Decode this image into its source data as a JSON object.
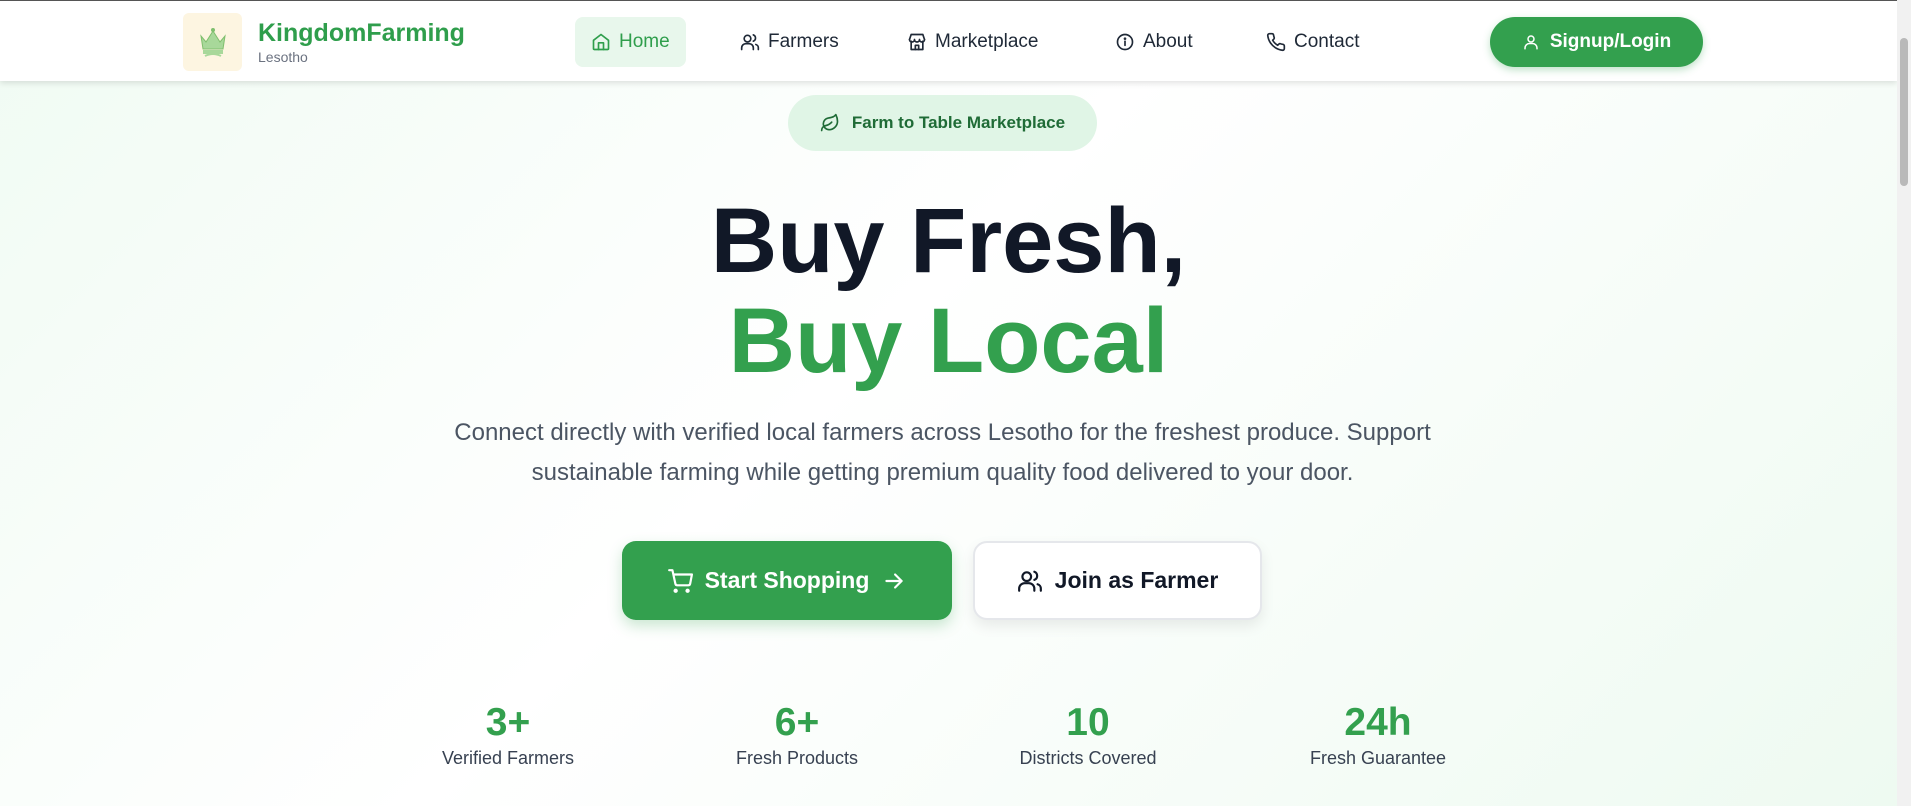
{
  "brand": {
    "name": "KingdomFarming",
    "subtitle": "Lesotho",
    "logo_icon": "crown-logo-icon"
  },
  "nav": {
    "items": [
      {
        "label": "Home",
        "icon": "home-icon",
        "active": true
      },
      {
        "label": "Farmers",
        "icon": "users-icon",
        "active": false
      },
      {
        "label": "Marketplace",
        "icon": "store-icon",
        "active": false
      },
      {
        "label": "About",
        "icon": "info-icon",
        "active": false
      },
      {
        "label": "Contact",
        "icon": "phone-icon",
        "active": false
      }
    ],
    "signup_label": "Signup/Login"
  },
  "hero": {
    "pill_label": "Farm to Table Marketplace",
    "headline_line1": "Buy Fresh,",
    "headline_line2": "Buy Local",
    "description": "Connect directly with verified local farmers across Lesotho for the freshest produce. Support sustainable farming while getting premium quality food delivered to your door.",
    "primary_button": "Start Shopping",
    "secondary_button": "Join as Farmer"
  },
  "stats": [
    {
      "value": "3+",
      "label": "Verified Farmers"
    },
    {
      "value": "6+",
      "label": "Fresh Products"
    },
    {
      "value": "10",
      "label": "Districts Covered"
    },
    {
      "value": "24h",
      "label": "Fresh Guarantee"
    }
  ],
  "colors": {
    "brand_green": "#33a04e",
    "dark_text": "#111827",
    "pill_bg": "#e0f5e6"
  }
}
